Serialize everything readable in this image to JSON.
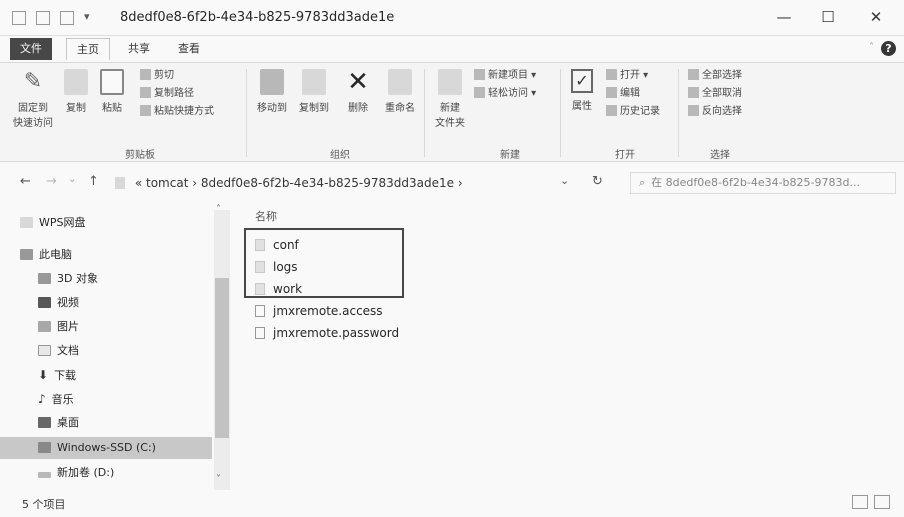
{
  "window": {
    "title": "8dedf0e8-6f2b-4e34-b825-9783dd3ade1e",
    "minimize_glyph": "—",
    "maximize_glyph": "☐",
    "close_glyph": "✕"
  },
  "tabs": {
    "file": "文件",
    "home": "主页",
    "share": "共享",
    "view": "查看",
    "help_glyph": "?"
  },
  "ribbon": {
    "pin_label_1": "固定到",
    "pin_label_2": "快速访问",
    "copy": "复制",
    "paste": "粘贴",
    "cut": "剪切",
    "copy_path": "复制路径",
    "paste_shortcut": "粘贴快捷方式",
    "move_to": "移动到",
    "copy_to": "复制到",
    "delete": "删除",
    "rename": "重命名",
    "new_folder_1": "新建",
    "new_folder_2": "文件夹",
    "new_item": "新建项目 ▾",
    "easy_access": "轻松访问 ▾",
    "properties": "属性",
    "open": "打开 ▾",
    "edit": "编辑",
    "history": "历史记录",
    "select_all": "全部选择",
    "select_none": "全部取消",
    "invert_selection": "反向选择",
    "groups": {
      "clipboard": "剪贴板",
      "organize": "组织",
      "new": "新建",
      "open": "打开",
      "select": "选择"
    }
  },
  "address": {
    "back_glyph": "←",
    "forward_glyph": "→",
    "recent_glyph": "⌄",
    "up_glyph": "↑",
    "path_prefix": "«",
    "path_parent": "tomcat",
    "path_sep": "›",
    "path_current": "8dedf0e8-6f2b-4e34-b825-9783dd3ade1e",
    "path_end": "›",
    "dropdown_glyph": "⌄",
    "refresh_glyph": "↻",
    "search_placeholder": "在 8dedf0e8-6f2b-4e34-b825-9783d...",
    "search_glyph": "⌕"
  },
  "nav_pane": {
    "items": [
      {
        "label": "WPS网盘"
      },
      {
        "label": "此电脑"
      },
      {
        "label": "3D 对象"
      },
      {
        "label": "视频"
      },
      {
        "label": "图片"
      },
      {
        "label": "文档"
      },
      {
        "label": "下载"
      },
      {
        "label": "音乐"
      },
      {
        "label": "桌面"
      },
      {
        "label": "Windows-SSD (C:)"
      },
      {
        "label": "新加卷 (D:)"
      }
    ],
    "scroll_up": "˄",
    "scroll_down": "˅"
  },
  "content": {
    "column_name": "名称",
    "files": [
      {
        "name": "conf",
        "type": "folder"
      },
      {
        "name": "logs",
        "type": "folder"
      },
      {
        "name": "work",
        "type": "folder"
      },
      {
        "name": "jmxremote.access",
        "type": "file"
      },
      {
        "name": "jmxremote.password",
        "type": "file"
      }
    ]
  },
  "status": {
    "count": "5 个项目"
  }
}
